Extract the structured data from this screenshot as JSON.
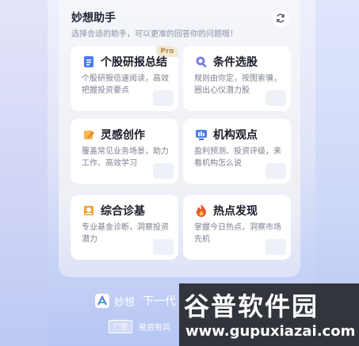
{
  "panel": {
    "title": "妙想助手",
    "subtitle": "选择合适的助手，可以更准的回答你的问题哦！"
  },
  "cards": [
    {
      "title": "个股研报总结",
      "desc": "个股研报倍速阅读，高效把握投资要点",
      "badge": "Pro",
      "icon": "document-icon"
    },
    {
      "title": "条件选股",
      "desc": "规则由你定，按图索骥，圈出心仪潜力股",
      "icon": "stock-filter-icon"
    },
    {
      "title": "灵感创作",
      "desc": "覆盖常见业务场景，助力工作、高效学习",
      "icon": "pen-icon"
    },
    {
      "title": "机构观点",
      "desc": "盈利预测、投资评级，来看机构怎么说",
      "icon": "institution-icon"
    },
    {
      "title": "综合诊基",
      "desc": "专业基金诊断，洞察投资潜力",
      "icon": "fund-diagnosis-icon"
    },
    {
      "title": "热点发现",
      "desc": "掌握今日热点，洞察市场先机",
      "icon": "flame-icon"
    }
  ],
  "footer": {
    "brand": "妙想",
    "slogan": "下一代",
    "ad_label": "广告",
    "ad_text": "投资有风"
  },
  "watermark": {
    "title": "谷普软件园",
    "url": "www.gupuxiazai.com"
  },
  "colors": {
    "accent": "#4a7cf0",
    "pro_badge": "#b58a4a",
    "flame": "#f0542f",
    "gold": "#e8a13a"
  }
}
